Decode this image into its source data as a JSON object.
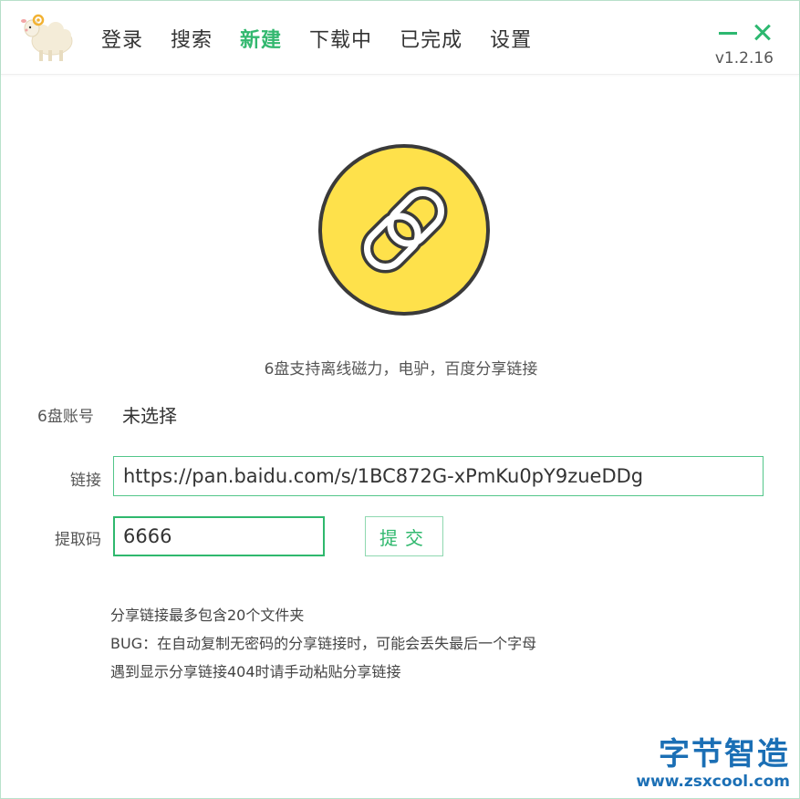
{
  "header": {
    "nav": [
      "登录",
      "搜索",
      "新建",
      "下载中",
      "已完成",
      "设置"
    ],
    "active_tab": "新建",
    "version": "v1.2.16"
  },
  "main": {
    "subtitle": "6盘支持离线磁力，电驴，百度分享链接",
    "account_label": "6盘账号",
    "account_value": "未选择",
    "link_label": "链接",
    "link_value": "https://pan.baidu.com/s/1BC872G-xPmKu0pY9zueDDg",
    "code_label": "提取码",
    "code_value": "6666",
    "submit_label": "提交",
    "notes": [
      "分享链接最多包含20个文件夹",
      "BUG：在自动复制无密码的分享链接时，可能会丢失最后一个字母",
      "遇到显示分享链接404时请手动粘贴分享链接"
    ]
  },
  "watermark": {
    "title": "字节智造",
    "url": "www.zsxcool.com"
  },
  "colors": {
    "accent": "#2fb86d",
    "hero_yellow": "#fee14b",
    "hero_outline": "#3a3a3a"
  },
  "icons": {
    "logo": "sheep-logo",
    "hero": "chain-link-icon",
    "minimize": "minimize-icon",
    "close": "close-icon"
  }
}
